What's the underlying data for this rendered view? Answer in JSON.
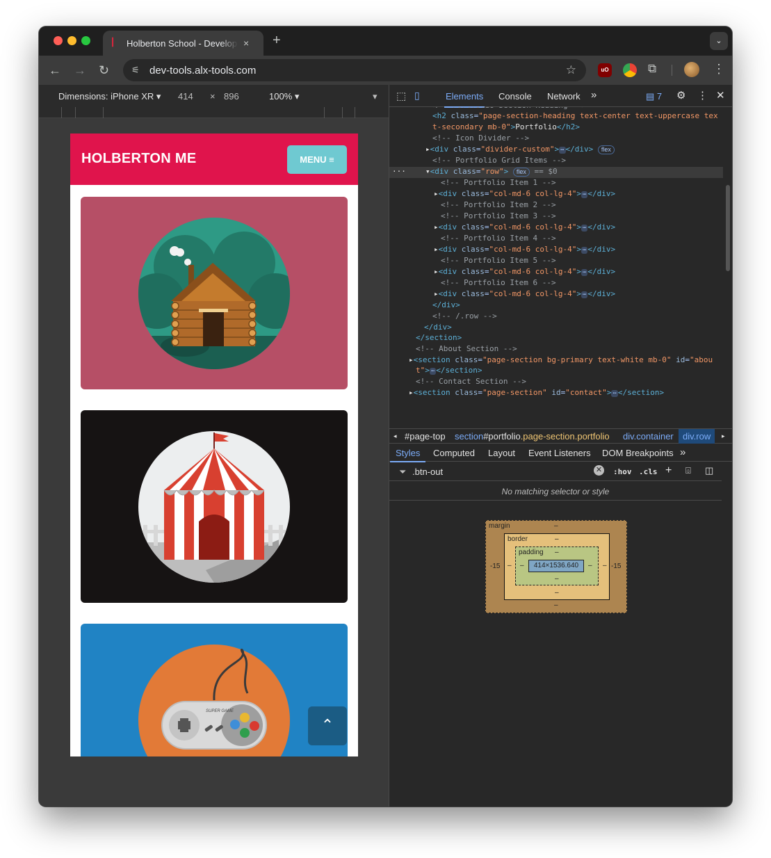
{
  "browser": {
    "tab_title": "Holberton School - Developer",
    "tab_close": "×",
    "new_tab": "+",
    "url": "dev-tools.alx-tools.com"
  },
  "device_toolbar": {
    "dimensions_label": "Dimensions: iPhone XR",
    "width": "414",
    "times": "×",
    "height": "896",
    "zoom": "100%"
  },
  "site": {
    "brand": "HOLBERTON ME",
    "menu_label": "MENU ≡",
    "portfolio_items": [
      {
        "icon": "log-cabin-illustration",
        "bg": "#b64f66"
      },
      {
        "icon": "circus-tent-illustration",
        "bg": "#161313"
      },
      {
        "icon": "game-controller-illustration",
        "bg": "#2083c4",
        "controller_text": "SUPER GAME"
      }
    ],
    "scroll_top_icon": "chevron-up-icon"
  },
  "devtools": {
    "tabs": [
      "Elements",
      "Console",
      "Network"
    ],
    "issues_count": "7",
    "more": "»",
    "breadcrumbs": {
      "c1": "#page-top",
      "c2a": "section",
      "c2b": "#portfolio",
      "c2c": ".page-section.portfolio",
      "c3a": "div",
      "c3b": ".container",
      "c4a": "div",
      "c4b": ".row"
    },
    "style_tabs": [
      "Styles",
      "Computed",
      "Layout",
      "Event Listeners",
      "DOM Breakpoints"
    ],
    "filter_value": ".btn-out",
    "hov": ":hov",
    "cls": ".cls",
    "no_match": "No matching selector or style",
    "box_model": {
      "margin_label": "margin",
      "border_label": "border",
      "padding_label": "padding",
      "content": "414×1536.640",
      "dash": "–",
      "margin_left": "-15",
      "margin_right": "-15"
    }
  }
}
